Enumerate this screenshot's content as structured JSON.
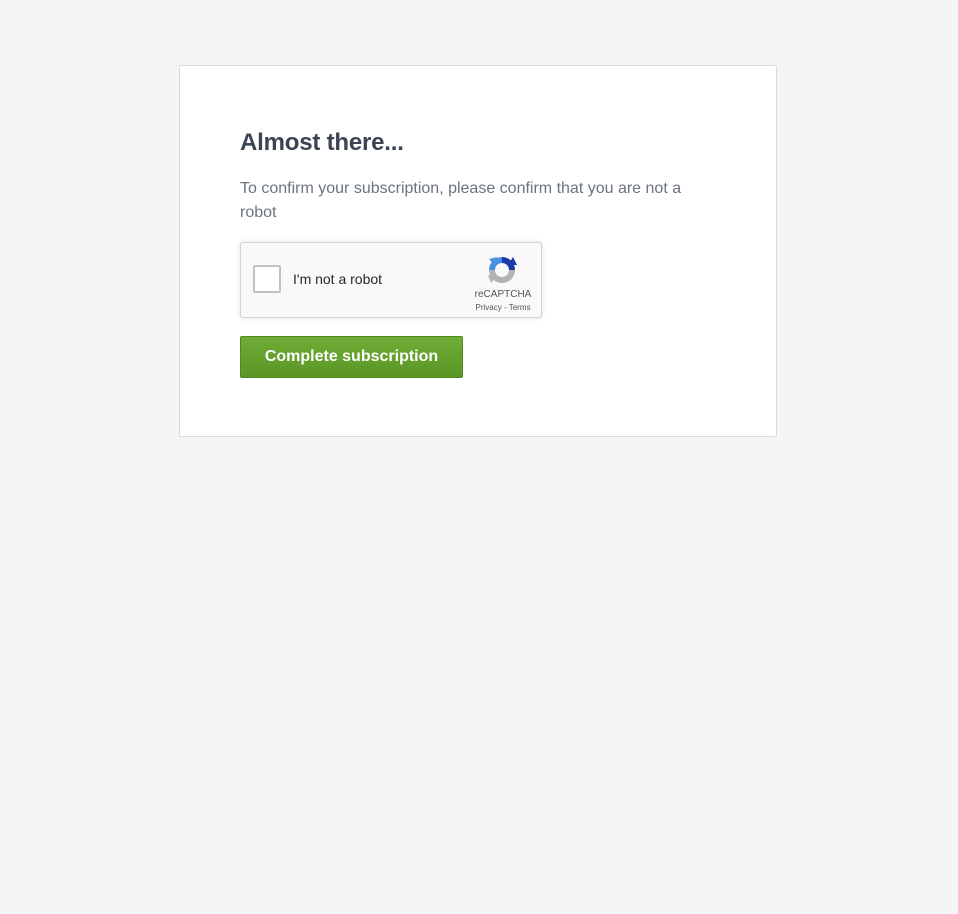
{
  "confirm_card": {
    "title": "Almost there...",
    "description": "To confirm your subscription, please confirm that you are not a robot"
  },
  "recaptcha": {
    "checkbox_label": "I'm not a robot",
    "brand": "reCAPTCHA",
    "privacy_link": "Privacy",
    "separator": " - ",
    "terms_link": "Terms",
    "icon": "recaptcha-logo-icon",
    "colors": {
      "logo_blue": "#1c3aa9",
      "logo_light_blue": "#4a90e2",
      "logo_gray": "#b3b3b3"
    }
  },
  "actions": {
    "complete_label": "Complete subscription",
    "button_color": "#65a22e"
  }
}
